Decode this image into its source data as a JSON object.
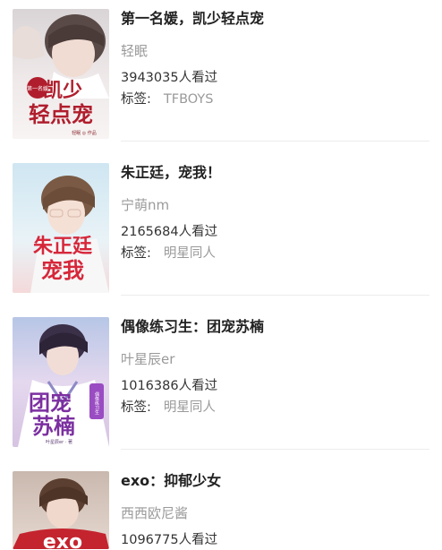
{
  "books": [
    {
      "title": "第一名媛，凯少轻点宠",
      "author": "轻眠",
      "views": "3943035",
      "views_suffix": "人看过",
      "tag_label": "标签:",
      "tag": "TFBOYS",
      "cover_text_main": "凯少",
      "cover_text_sub": "轻点宠",
      "cover_badge": "第一名媛",
      "cover_credit": "轻眠 ◎ 作品"
    },
    {
      "title": "朱正廷，宠我！",
      "author": "宁萌nm",
      "views": "2165684",
      "views_suffix": "人看过",
      "tag_label": "标签:",
      "tag": "明星同人",
      "cover_text_main": "朱正廷",
      "cover_text_sub": "宠我"
    },
    {
      "title": "偶像练习生：团宠苏楠",
      "author": "叶星辰er",
      "views": "1016386",
      "views_suffix": "人看过",
      "tag_label": "标签:",
      "tag": "明星同人",
      "cover_text_main": "团宠",
      "cover_text_sub": "苏楠",
      "cover_badge": "偶像练习生",
      "cover_credit": "叶星辰er · 著"
    },
    {
      "title": "exo：抑郁少女",
      "author": "西西欧尼酱",
      "views": "1096775",
      "views_suffix": "人看过",
      "cover_text_main": "exo"
    }
  ],
  "colors": {
    "title": "#222222",
    "muted": "#9a9a9a",
    "text": "#333333",
    "divider": "#ececec"
  }
}
